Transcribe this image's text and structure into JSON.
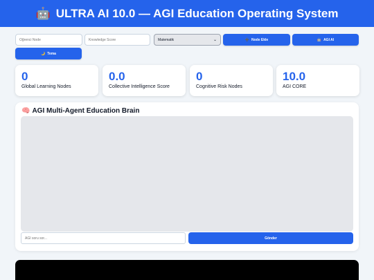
{
  "header": {
    "icon": "robot-icon",
    "title": "ULTRA AI 10.0 — AGI Education Operating System"
  },
  "controls": {
    "student_placeholder": "Öğrenci Node",
    "score_placeholder": "Knowledge Score",
    "subject_selected": "Matematik",
    "add_node_label": "Node Ekle",
    "agi_ai_label": "AGI AI",
    "theme_label": "Tema"
  },
  "stats": [
    {
      "value": "0",
      "label": "Global Learning Nodes"
    },
    {
      "value": "0.0",
      "label": "Collective Intelligence Score"
    },
    {
      "value": "0",
      "label": "Cognitive Risk Nodes"
    },
    {
      "value": "10.0",
      "label": "AGI CORE"
    }
  ],
  "brain": {
    "title": "AGI Multi-Agent Education Brain",
    "ask_placeholder": "AGI soru sor...",
    "send_label": "Gönder"
  },
  "colors": {
    "accent": "#2563eb",
    "background": "#f1f5f9"
  }
}
